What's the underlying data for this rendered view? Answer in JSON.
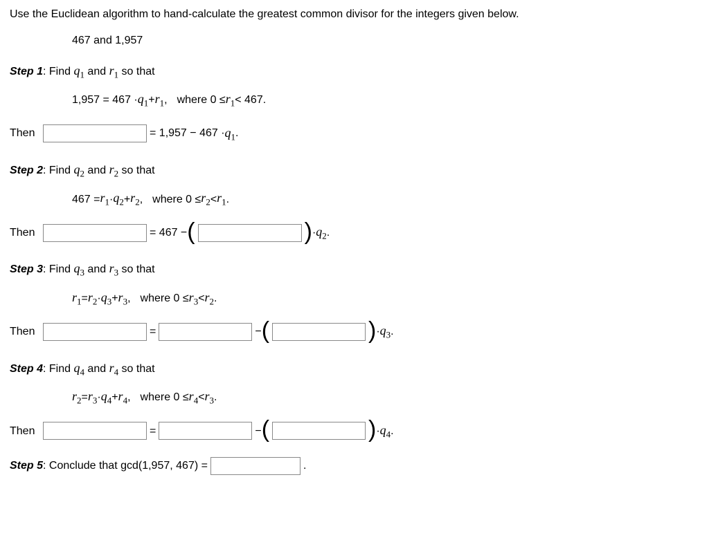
{
  "question": "Use the Euclidean algorithm to hand-calculate the greatest common divisor for the integers given below.",
  "given": "467 and 1,957",
  "steps": {
    "s1": {
      "label": "Step 1",
      "prompt_prefix": ": Find ",
      "prompt_suffix": " so that",
      "equation_text": "1,957 = 467 · ",
      "where": "where 0 ≤ ",
      "where_end": " < 467.",
      "then": "Then",
      "after": " = 1,957 − 467 · "
    },
    "s2": {
      "label": "Step 2",
      "prompt_prefix": ": Find ",
      "prompt_suffix": " so that",
      "equation_text": "467 = ",
      "where": "where 0 ≤ ",
      "where_end": " < ",
      "then": "Then",
      "after": " = 467 − ",
      "after2": " · "
    },
    "s3": {
      "label": "Step 3",
      "prompt_prefix": ": Find ",
      "prompt_suffix": " so that",
      "where": "where 0 ≤ ",
      "where_end": " < ",
      "then": "Then",
      "eq": " = ",
      "minus": " − ",
      "mult": " · "
    },
    "s4": {
      "label": "Step 4",
      "prompt_prefix": ": Find ",
      "prompt_suffix": " so that",
      "where": "where 0 ≤ ",
      "where_end": " < ",
      "then": "Then",
      "eq": " = ",
      "minus": " − ",
      "mult": " · "
    },
    "s5": {
      "label": "Step 5",
      "text": ": Conclude that gcd(1,957, 467) = ",
      "period": "."
    }
  },
  "vars": {
    "and": " and ",
    "plus": " + ",
    "comma": ",",
    "q": "q",
    "r": "r",
    "dot_mid": " · ",
    "eq": " = ",
    "period": "."
  }
}
